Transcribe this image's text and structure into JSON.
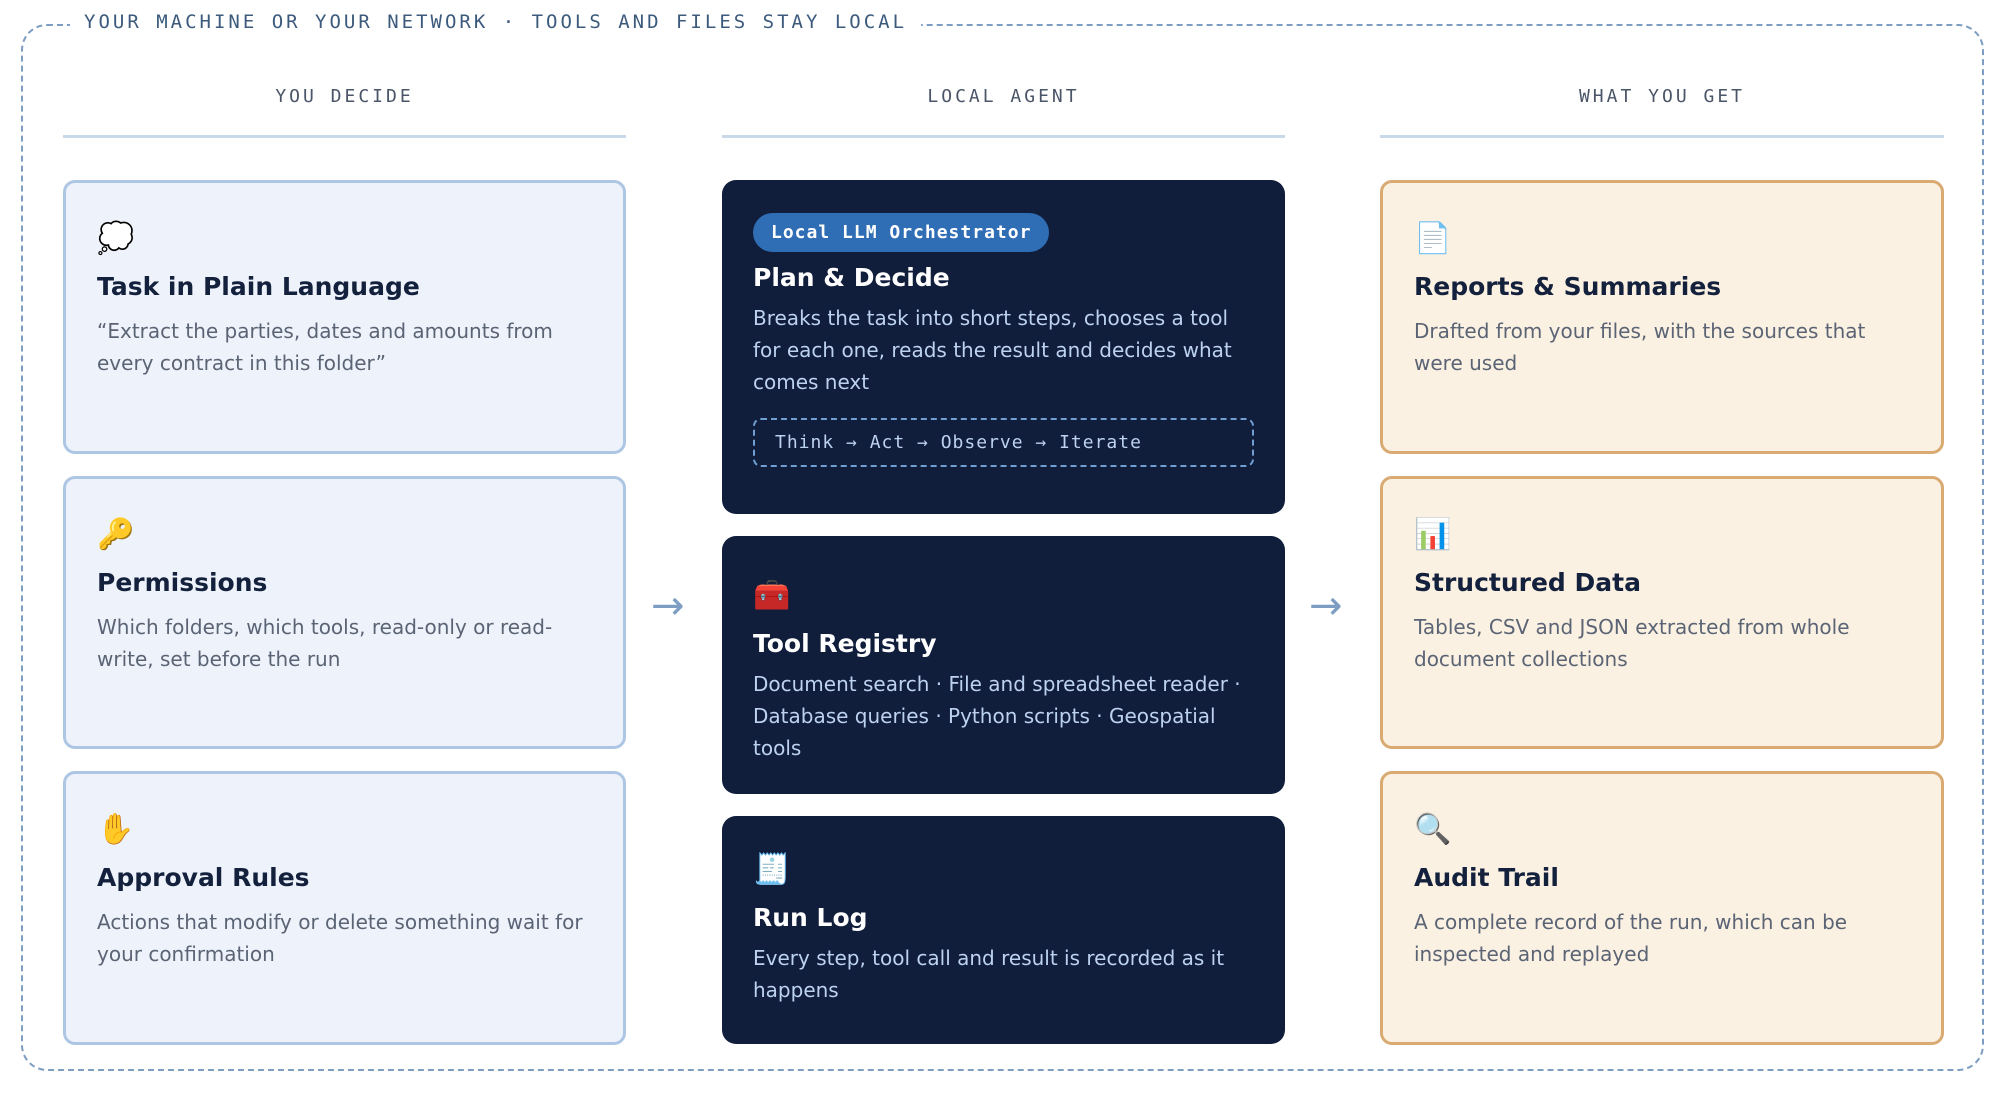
{
  "frame_label": "YOUR MACHINE OR YOUR NETWORK · TOOLS AND FILES STAY LOCAL",
  "columns": [
    {
      "heading": "YOU DECIDE"
    },
    {
      "heading": "LOCAL AGENT"
    },
    {
      "heading": "WHAT YOU GET"
    }
  ],
  "decide": [
    {
      "icon": "speech-bubble-icon",
      "glyph": "💭",
      "title": "Task in Plain Language",
      "desc": "“Extract the parties, dates and amounts from every contract in this folder”"
    },
    {
      "icon": "key-icon",
      "glyph": "🔑",
      "title": "Permissions",
      "desc": "Which folders, which tools, read-only or read-write, set before the run"
    },
    {
      "icon": "raised-hand-icon",
      "glyph": "✋",
      "title": "Approval Rules",
      "desc": "Actions that modify or delete something wait for your confirmation"
    }
  ],
  "agent": {
    "orchestrator": {
      "badge": "Local LLM Orchestrator",
      "title": "Plan & Decide",
      "desc": "Breaks the task into short steps, chooses a tool for each one, reads the result and decides what comes next",
      "loop": "Think → Act → Observe → Iterate"
    },
    "registry": {
      "icon": "toolbox-icon",
      "glyph": "🧰",
      "title": "Tool Registry",
      "desc": "Document search · File and spreadsheet reader · Database queries · Python scripts · Geospatial tools"
    },
    "runlog": {
      "icon": "receipt-icon",
      "glyph": "🧾",
      "title": "Run Log",
      "desc": "Every step, tool call and result is recorded as it happens"
    }
  },
  "outputs": [
    {
      "icon": "document-icon",
      "glyph": "📄",
      "title": "Reports & Summaries",
      "desc": "Drafted from your files, with the sources that were used"
    },
    {
      "icon": "bar-chart-icon",
      "glyph": "📊",
      "title": "Structured Data",
      "desc": "Tables, CSV and JSON extracted from whole document collections"
    },
    {
      "icon": "magnifier-icon",
      "glyph": "🔍",
      "title": "Audit Trail",
      "desc": "A complete record of the run, which can be inspected and replayed"
    }
  ],
  "arrow_glyph": "→"
}
